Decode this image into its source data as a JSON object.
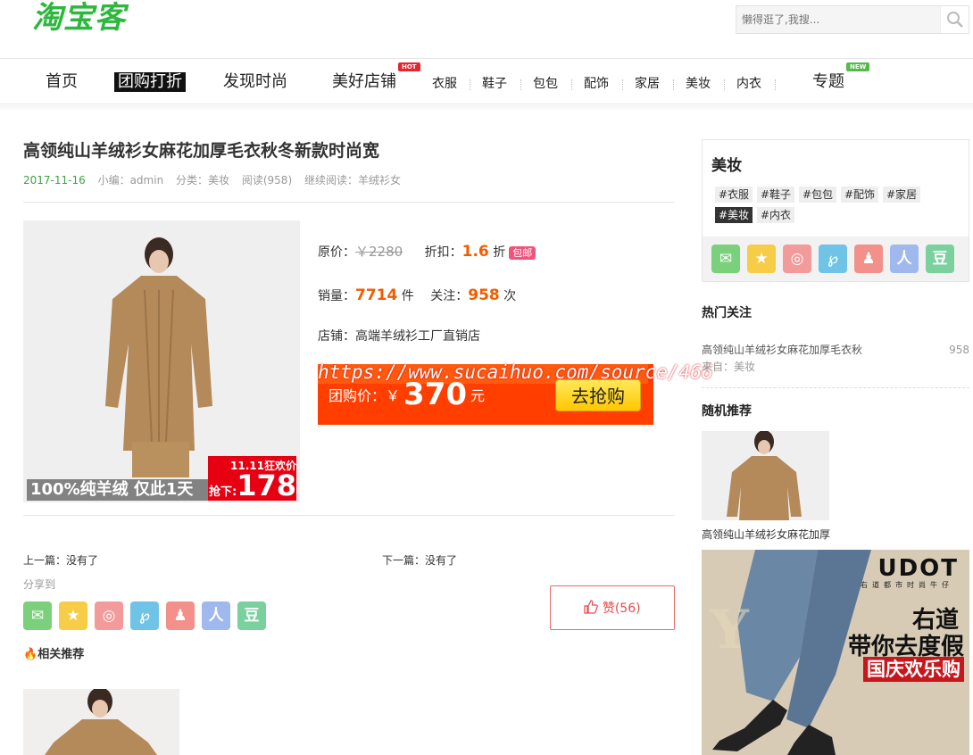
{
  "header": {
    "logo": "淘宝客",
    "search_placeholder": "懒得逛了,我搜..."
  },
  "nav": {
    "home": "首页",
    "group_deals": "团购打折",
    "discover": "发现时尚",
    "shops": "美好店铺",
    "shops_badge": "HOT",
    "clothes": "衣服",
    "shoes": "鞋子",
    "bags": "包包",
    "accessories": "配饰",
    "home_goods": "家居",
    "beauty": "美妆",
    "underwear": "内衣",
    "topics": "专题",
    "topics_badge": "NEW"
  },
  "article": {
    "title": "高领纯山羊绒衫女麻花加厚毛衣秋冬新款时尚宽",
    "date": "2017-11-16",
    "editor": "小编：admin",
    "category": "分类：美妆",
    "reads": "阅读(958)",
    "continue": "继续阅读：羊绒衫女"
  },
  "product": {
    "image_caption": "100%纯羊绒 仅此1天",
    "image_promo": "11.11狂欢价",
    "image_price_label": "抢下:",
    "image_price": "178",
    "original_label": "原价：",
    "original_price": "￥2280",
    "discount_label": "折扣：",
    "discount_value": "1.6",
    "discount_unit": "折",
    "free_shipping": "包邮",
    "sales_label": "销量：",
    "sales_value": "7714",
    "sales_unit": "件",
    "follow_label": "关注：",
    "follow_value": "958",
    "follow_unit": "次",
    "shop_label": "店铺：",
    "shop_name": "高端羊绒衫工厂直销店",
    "watermark": "https://www.sucaihuo.com/source/466",
    "group_label": "团购价：",
    "currency": "￥",
    "group_price": "370",
    "yuan": "元",
    "buy_button": "去抢购"
  },
  "post_nav": {
    "prev": "上一篇：没有了",
    "next": "下一篇：没有了",
    "share_label": "分享到",
    "like_label": "赞(56)",
    "related": "相关推荐"
  },
  "share_icons": [
    {
      "name": "wechat-icon",
      "glyph": "✉",
      "color": "#7bd07c"
    },
    {
      "name": "qzone-icon",
      "glyph": "★",
      "color": "#f7cd48"
    },
    {
      "name": "weibo-icon",
      "glyph": "◎",
      "color": "#f39a9a"
    },
    {
      "name": "tencent-weibo-icon",
      "glyph": "℘",
      "color": "#6ec3e6"
    },
    {
      "name": "qq-icon",
      "glyph": "♟",
      "color": "#f29089"
    },
    {
      "name": "renren-icon",
      "glyph": "人",
      "color": "#9fb9ee"
    },
    {
      "name": "douban-icon",
      "glyph": "豆",
      "color": "#7ad19e"
    }
  ],
  "sidebar": {
    "category_title": "美妆",
    "tags": [
      "#衣服",
      "#鞋子",
      "#包包",
      "#配饰",
      "#家居",
      "#美妆",
      "#内衣"
    ],
    "hot_title": "热门关注",
    "hot_item": "高领纯山羊绒衫女麻花加厚毛衣秋",
    "hot_count": "958",
    "hot_from": "来自：美妆",
    "random_title": "随机推荐",
    "random_caption": "高领纯山羊绒衫女麻花加厚",
    "ad_brand": "UDOT",
    "ad_sub": "右道都市时尚牛仔",
    "ad_line1": "右道",
    "ad_line2": "带你去度假",
    "ad_line3": "国庆欢乐购"
  }
}
